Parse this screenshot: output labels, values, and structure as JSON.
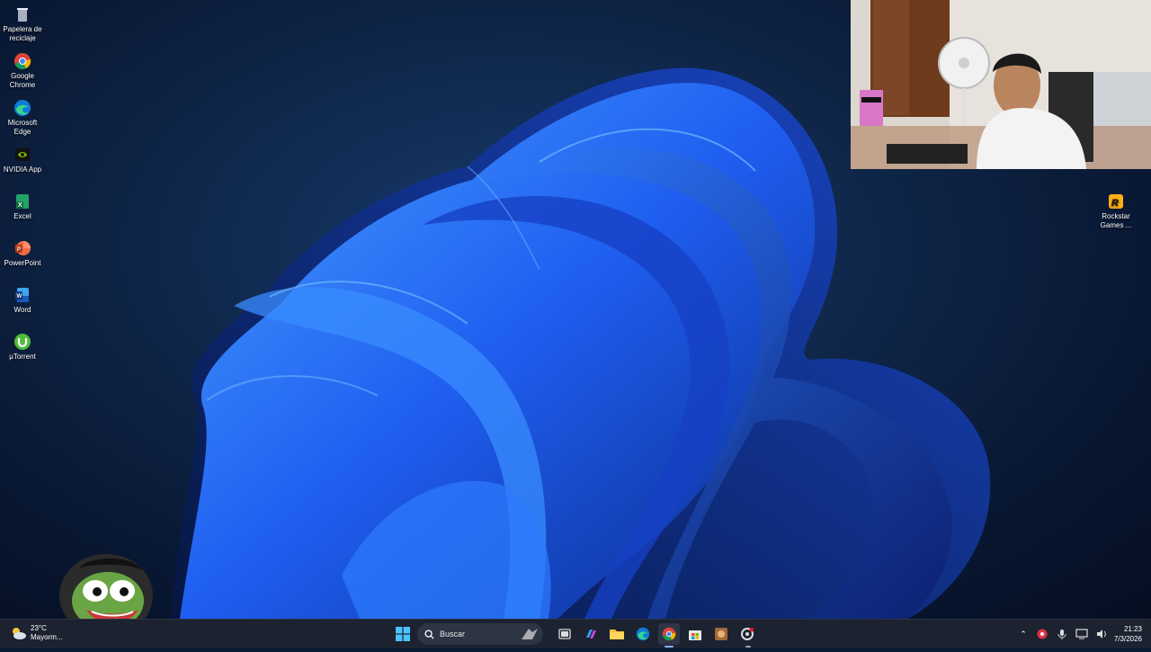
{
  "desktop": {
    "icons_left": [
      {
        "label": "Papelera de reciclaje",
        "icon": "recycle-bin-icon"
      },
      {
        "label": "Google Chrome",
        "icon": "chrome-icon"
      },
      {
        "label": "Microsoft Edge",
        "icon": "edge-icon"
      },
      {
        "label": "NVIDIA App",
        "icon": "nvidia-icon"
      },
      {
        "label": "Excel",
        "icon": "excel-icon"
      },
      {
        "label": "PowerPoint",
        "icon": "powerpoint-icon"
      },
      {
        "label": "Word",
        "icon": "word-icon"
      },
      {
        "label": "µTorrent",
        "icon": "utorrent-icon"
      }
    ],
    "icon_right": {
      "label": "Rockstar Games ...",
      "icon": "rockstar-icon"
    }
  },
  "taskbar": {
    "weather": {
      "temp": "23°C",
      "desc": "Mayorm..."
    },
    "search_placeholder": "Buscar",
    "pinned": [
      "start-icon",
      "search-icon",
      "task-view-icon",
      "copilot-icon",
      "file-explorer-icon",
      "edge-icon",
      "chrome-icon",
      "store-icon",
      "game-icon",
      "settings-icon"
    ],
    "tray": [
      "chevron-up-icon",
      "app-tray-icon",
      "mic-icon",
      "display-icon",
      "volume-icon"
    ],
    "clock": {
      "time": "21:23",
      "date": "7/3/2026"
    }
  },
  "colors": {
    "taskbar_bg": "#1c2230",
    "wallpaper_accent": "#1f5ef0"
  }
}
